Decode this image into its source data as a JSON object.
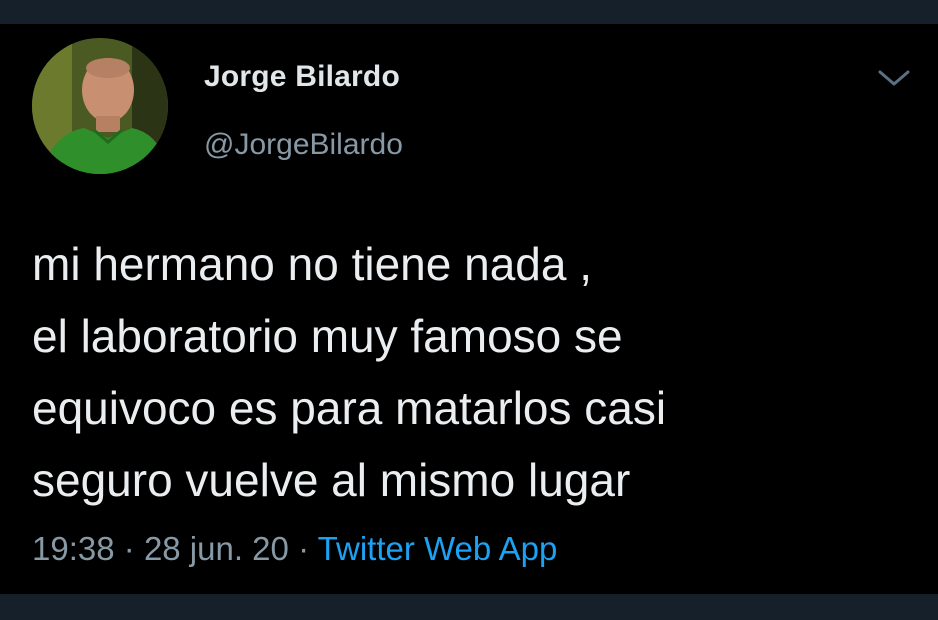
{
  "author": {
    "name": "Jorge Bilardo",
    "handle": "@JorgeBilardo"
  },
  "tweet": {
    "lines": [
      "mi hermano no tiene nada ,",
      "el laboratorio muy famoso se",
      "equivoco es para matarlos casi",
      "seguro vuelve al mismo lugar"
    ]
  },
  "meta": {
    "time": "19:38",
    "separator": "·",
    "date": "28 jun. 20",
    "source": "Twitter Web App"
  },
  "icons": {
    "menu": "chevron-down-icon",
    "avatar": "profile-photo"
  },
  "colors": {
    "background": "#000000",
    "frame": "#15202b",
    "text": "#ebeef0",
    "muted": "#8899a6",
    "link": "#1da1f2"
  }
}
